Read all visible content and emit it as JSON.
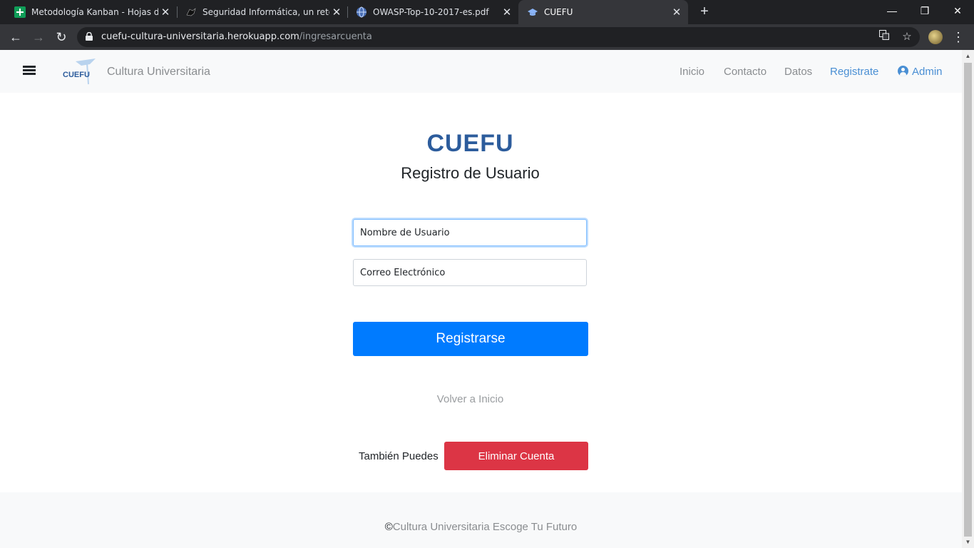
{
  "browser": {
    "tabs": [
      {
        "title": "Metodología Kanban - Hojas de cálculo",
        "favicon": "sheets-icon",
        "color": "#0f9d58"
      },
      {
        "title": "Seguridad Informática, un reto para",
        "favicon": "panther-icon",
        "color": "#202124"
      },
      {
        "title": "OWASP-Top-10-2017-es.pdf",
        "favicon": "globe-icon",
        "color": "#4a6fb5"
      },
      {
        "title": "CUEFU",
        "favicon": "cuefu-icon",
        "color": "#8ab4f8"
      }
    ],
    "new_tab": "+",
    "url_host": "cuefu-cultura-universitaria.herokuapp.com",
    "url_path": "/ingresarcuenta"
  },
  "site": {
    "brand_logo_text": "CUEFU",
    "brand_name": "Cultura Universitaria",
    "nav": [
      "Inicio",
      "Contacto",
      "Datos",
      "Registrate",
      "Admin"
    ]
  },
  "main": {
    "logo_title": "CUEFU",
    "heading": "Registro de Usuario",
    "username_placeholder": "Nombre de Usuario",
    "email_placeholder": "Correo Electrónico",
    "register_button": "Registrarse",
    "back_link": "Volver a Inicio",
    "also_label": "También Puedes",
    "delete_button": "Eliminar Cuenta"
  },
  "footer": {
    "copyright_symbol": "©",
    "text": "Cultura Universitaria Escoge Tu Futuro"
  },
  "colors": {
    "primary": "#007bff",
    "danger": "#dc3545",
    "brand_blue": "#2c5c9c",
    "link_blue": "#4a8fd4"
  }
}
